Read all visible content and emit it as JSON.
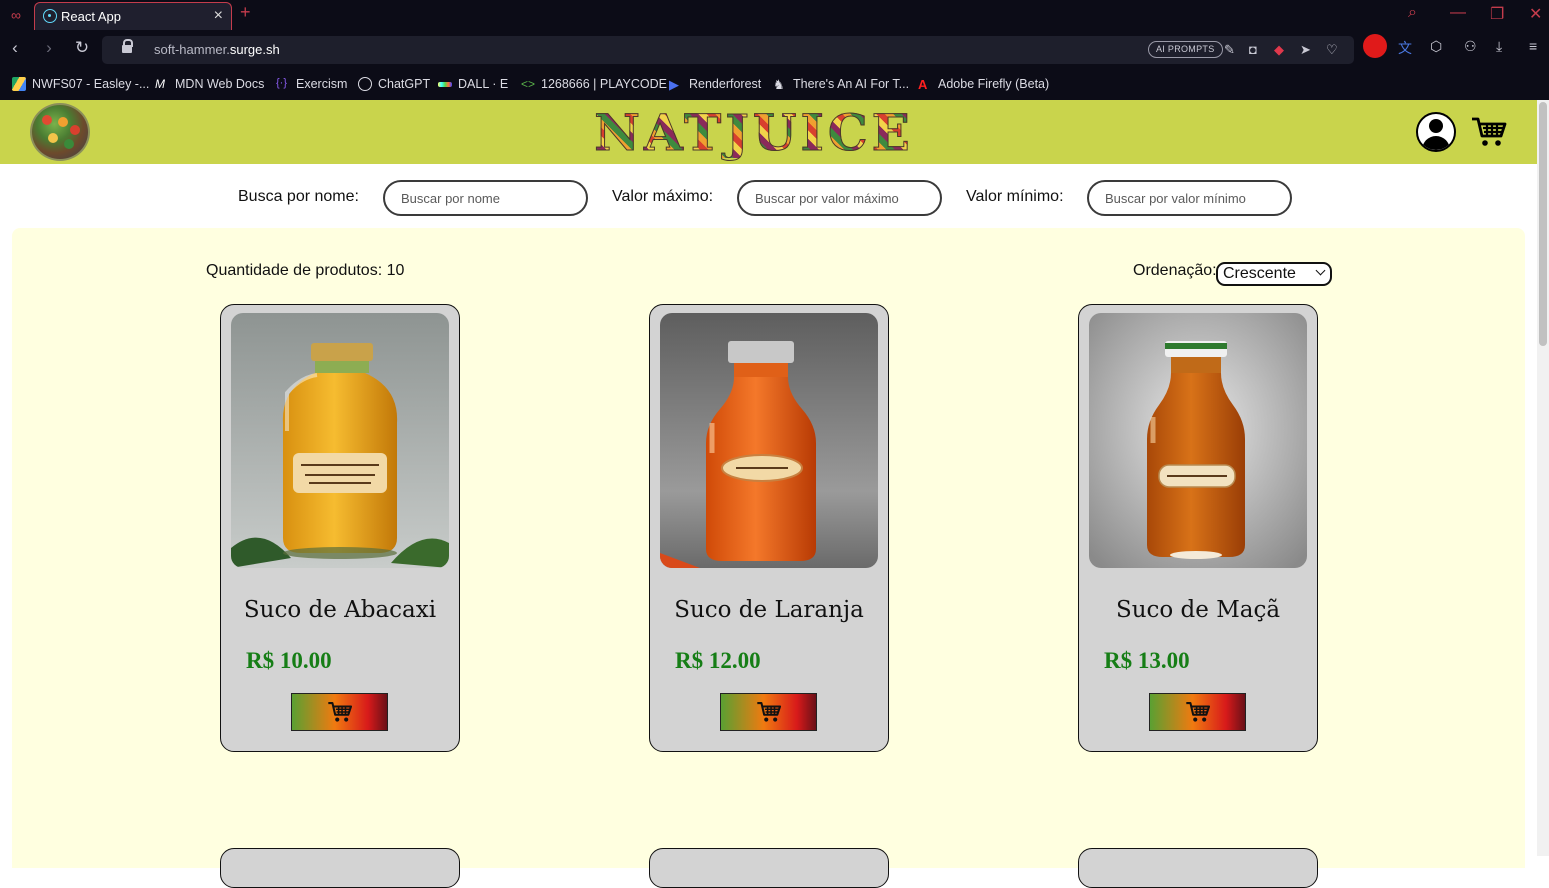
{
  "browser": {
    "tab_title": "React App",
    "url_prefix": "soft-hammer.",
    "url_domain": "surge.sh",
    "ai_prompts": "AI PROMPTS",
    "bookmarks": [
      {
        "label": "NWFS07 - Easley -...",
        "icon": "google-drive-icon"
      },
      {
        "label": "MDN Web Docs",
        "icon": "mdn-icon"
      },
      {
        "label": "Exercism",
        "icon": "exercism-icon"
      },
      {
        "label": "ChatGPT",
        "icon": "chatgpt-icon"
      },
      {
        "label": "DALL · E",
        "icon": "dalle-icon"
      },
      {
        "label": "1268666 | PLAYCODE",
        "icon": "playcode-icon"
      },
      {
        "label": "Renderforest",
        "icon": "renderforest-icon"
      },
      {
        "label": "There's An AI For T...",
        "icon": "aiforthat-icon"
      },
      {
        "label": "Adobe Firefly (Beta)",
        "icon": "adobe-icon"
      }
    ]
  },
  "header": {
    "brand": "NATJUICE",
    "accent": "#c9d44c"
  },
  "filters": {
    "name_label": "Busca por nome:",
    "name_placeholder": "Buscar por nome",
    "max_label": "Valor máximo:",
    "max_placeholder": "Buscar por valor máximo",
    "min_label": "Valor mínimo:",
    "min_placeholder": "Buscar por valor mínimo"
  },
  "products_panel": {
    "count_label": "Quantidade de produtos: 10",
    "order_label": "Ordenação:",
    "order_value": "Crescente",
    "background": "#ffffe0"
  },
  "products": [
    {
      "name": "Suco de Abacaxi",
      "price": "R$ 10.00"
    },
    {
      "name": "Suco de Laranja",
      "price": "R$ 12.00"
    },
    {
      "name": "Suco de Maçã",
      "price": "R$ 13.00"
    }
  ],
  "price_color": "#167e16"
}
